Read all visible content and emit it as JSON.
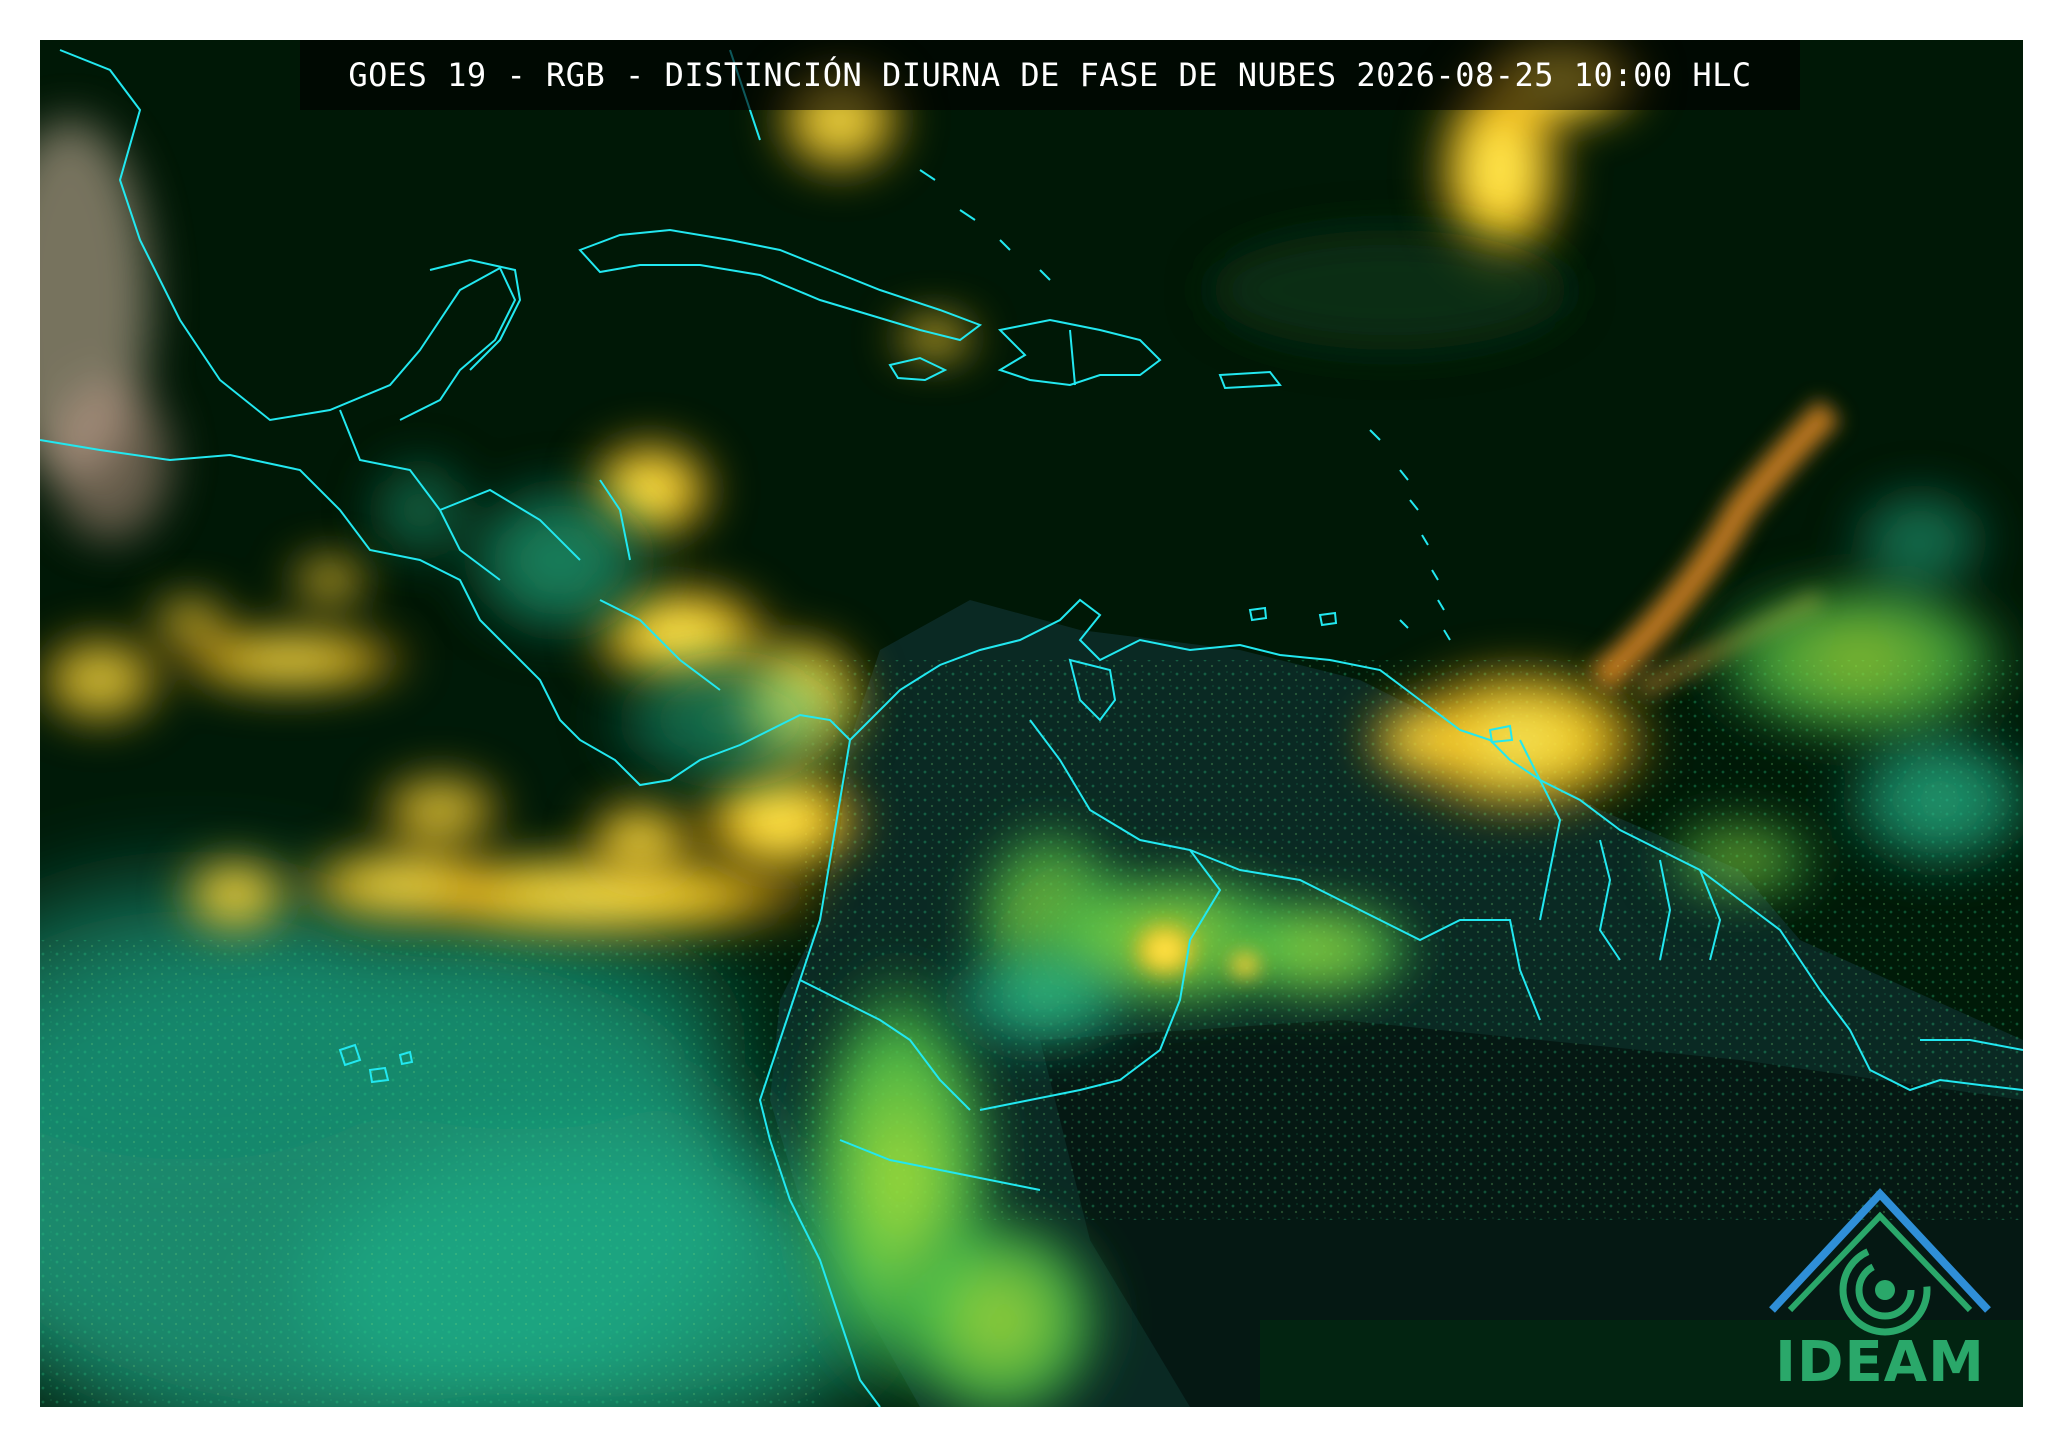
{
  "title": "GOES 19 - RGB - DISTINCIÓN DIURNA DE FASE DE NUBES 2026-08-25 10:00 HLC",
  "logo": {
    "text": "IDEAM",
    "icon": "ideam-logo-icon"
  },
  "colors": {
    "ocean_background": "#001a08",
    "border_lines": "#22e8f0",
    "water_cloud": "#19b38a",
    "ice_cloud_thick": "#ffe833",
    "ice_cloud_edge": "#ff9a1e",
    "logo": "#2aa86a",
    "title_text": "#ffffff"
  }
}
